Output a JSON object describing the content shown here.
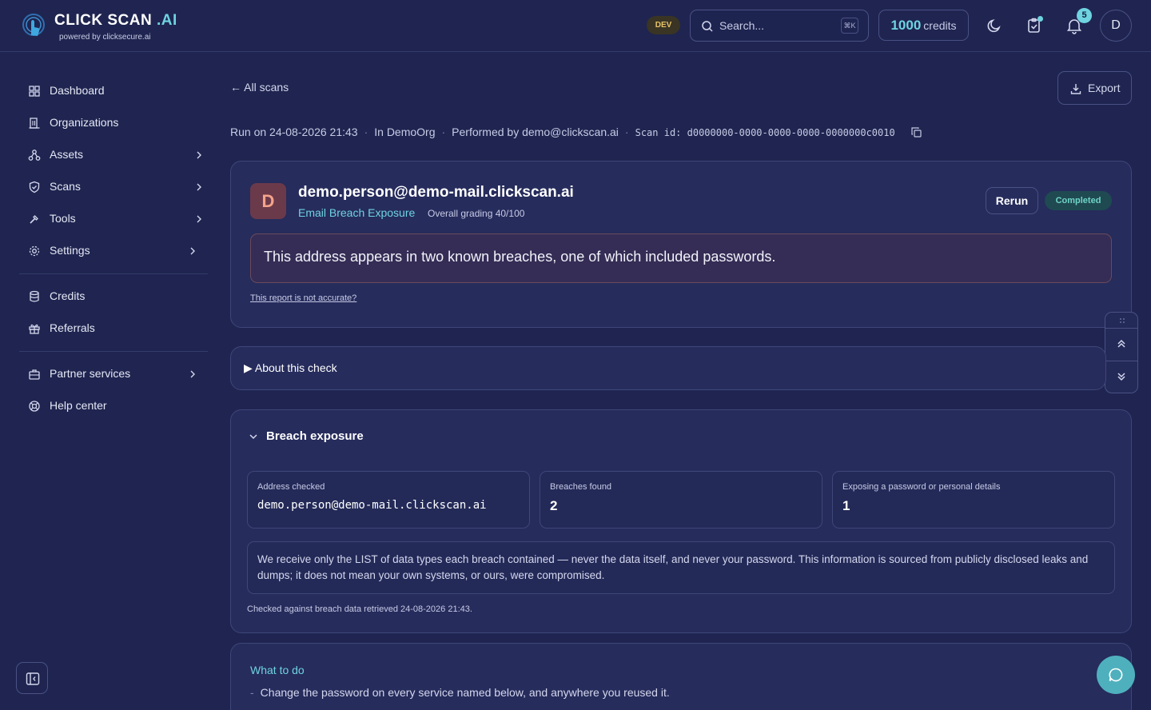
{
  "brand": {
    "name": "CLICK SCAN",
    "suffix": ".AI",
    "powered_by": "powered by clicksecure.ai"
  },
  "header": {
    "env_badge": "DEV",
    "search_placeholder": "Search...",
    "search_shortcut": "⌘K",
    "credits_value": "1000",
    "credits_label": "credits",
    "notification_count": "5",
    "avatar_initial": "D"
  },
  "sidebar": {
    "items": [
      {
        "label": "Dashboard",
        "icon": "dashboard-icon"
      },
      {
        "label": "Organizations",
        "icon": "building-icon"
      },
      {
        "label": "Assets",
        "icon": "assets-icon"
      },
      {
        "label": "Scans",
        "icon": "shield-icon"
      },
      {
        "label": "Tools",
        "icon": "tools-icon"
      },
      {
        "label": "Settings",
        "icon": "gear-icon"
      },
      {
        "label": "Credits",
        "icon": "database-icon"
      },
      {
        "label": "Referrals",
        "icon": "gift-icon"
      },
      {
        "label": "Partner services",
        "icon": "briefcase-icon"
      },
      {
        "label": "Help center",
        "icon": "lifebuoy-icon"
      }
    ]
  },
  "scan": {
    "back_label": "All scans",
    "export_label": "Export",
    "run_on": "Run on 24-08-2026 21:43",
    "org": "In DemoOrg",
    "performed_by": "Performed by demo@clickscan.ai",
    "scan_id": "Scan id: d0000000-0000-0000-0000-0000000c0010"
  },
  "result": {
    "avatar_initial": "D",
    "target": "demo.person@demo-mail.clickscan.ai",
    "check_name": "Email Breach Exposure",
    "grading": "Overall grading 40/100",
    "rerun_label": "Rerun",
    "status": "Completed",
    "summary": "This address appears in two known breaches, one of which included passwords.",
    "inaccurate_link": "This report is not accurate?"
  },
  "about": {
    "label": "▶ About this check"
  },
  "breach": {
    "title": "Breach exposure",
    "stats": [
      {
        "label": "Address checked",
        "value": "demo.person@demo-mail.clickscan.ai"
      },
      {
        "label": "Breaches found",
        "value": "2"
      },
      {
        "label": "Exposing a password or personal details",
        "value": "1"
      }
    ],
    "note": "We receive only the LIST of data types each breach contained — never the data itself, and never your password. This information is sourced from publicly disclosed leaks and dumps; it does not mean your own systems, or ours, were compromised.",
    "checked_against": "Checked against breach data retrieved 24-08-2026 21:43."
  },
  "todo": {
    "title": "What to do",
    "items": [
      "Change the password on every service named below, and anywhere you reused it."
    ]
  }
}
